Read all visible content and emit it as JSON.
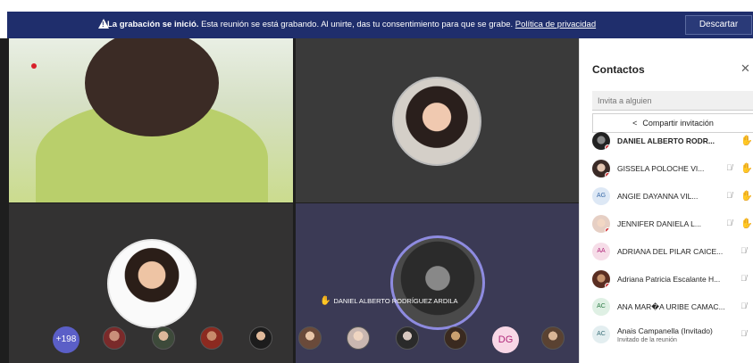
{
  "banner": {
    "title": "La grabación se inició.",
    "message": "Esta reunión se está grabando. Al unirte, das tu consentimiento para que se grabe.",
    "link": "Política de privacidad",
    "dismiss_label": "Descartar",
    "warning_icon": "warning-icon"
  },
  "stage": {
    "speaker_name": "DANIEL ALBERTO RODRÍGUEZ ARDILA",
    "more_count": "+198",
    "dg_initials": "DG"
  },
  "panel": {
    "title": "Contactos",
    "invite_placeholder": "Invita a alguien",
    "share_label": "Compartir invitación",
    "people": [
      {
        "name": "DANIEL ALBERTO RODR...",
        "initials": "",
        "bold": true,
        "muted": false,
        "raised": true
      },
      {
        "name": "GISSELA POLOCHE VI...",
        "initials": "",
        "bold": false,
        "muted": true,
        "raised": true
      },
      {
        "name": "ANGIE DAYANNA VIL...",
        "initials": "AG",
        "bold": false,
        "muted": true,
        "raised": true
      },
      {
        "name": "JENNIFER DANIELA L...",
        "initials": "",
        "bold": false,
        "muted": true,
        "raised": true
      },
      {
        "name": "ADRIANA DEL PILAR CAICE...",
        "initials": "AA",
        "bold": false,
        "muted": true,
        "raised": false
      },
      {
        "name": "Adriana Patricia Escalante H...",
        "initials": "",
        "bold": false,
        "muted": true,
        "raised": false
      },
      {
        "name": "ANA MAR�A URIBE CAMAC...",
        "initials": "AC",
        "bold": false,
        "muted": true,
        "raised": false
      },
      {
        "name": "Anais Campanella (Invitado)",
        "sub": "Invitado de la reunión",
        "initials": "AC",
        "bold": false,
        "muted": true,
        "raised": false
      }
    ]
  },
  "colors": {
    "banner_bg": "#1f2e6c",
    "accent": "#5b5fc7",
    "raise_hand": "#f5b621",
    "status_busy": "#d13438"
  }
}
